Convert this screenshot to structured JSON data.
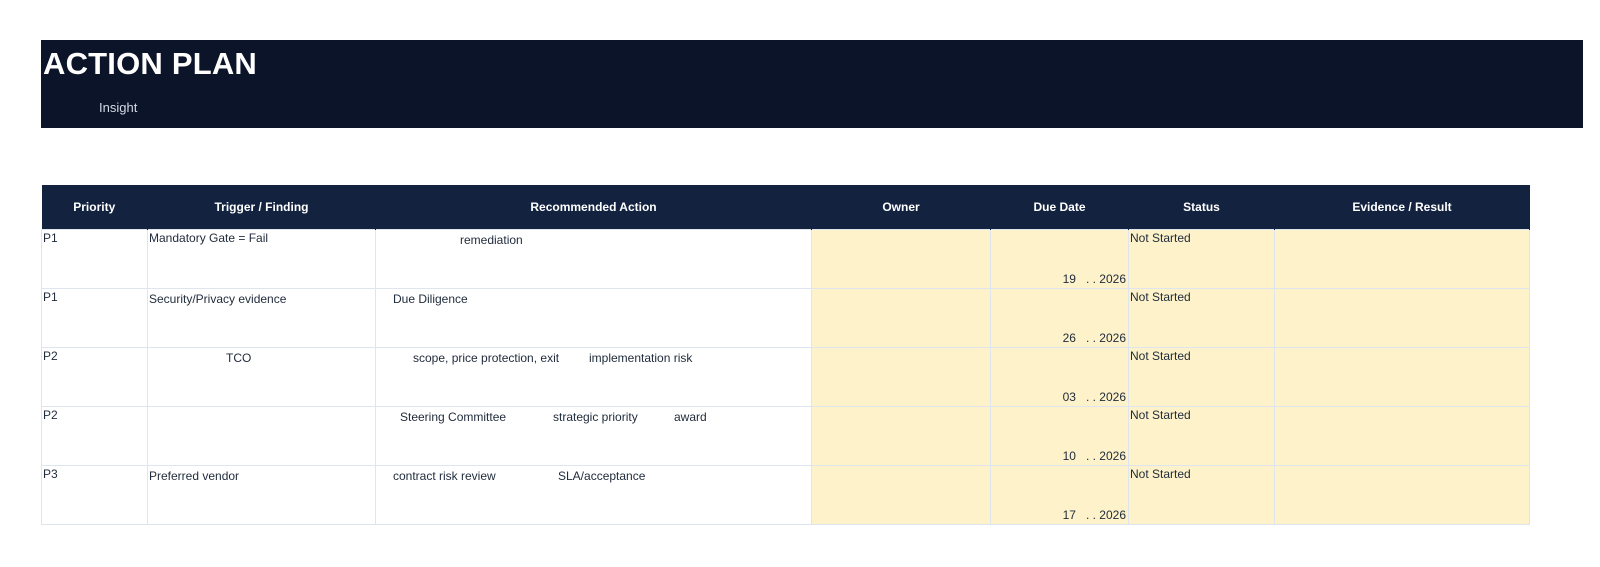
{
  "header": {
    "title": "ACTION PLAN",
    "subtitle": "Insight"
  },
  "table": {
    "columns": [
      "Priority",
      "Trigger / Finding",
      "Recommended Action",
      "Owner",
      "Due Date",
      "Status",
      "Evidence / Result"
    ],
    "rows": [
      {
        "priority": "P1",
        "trigger": "Mandatory Gate = Fail",
        "action": [
          "remediation"
        ],
        "owner": "",
        "due_day": "19",
        "due_sep": ". .",
        "due_year": "2026",
        "status": "Not Started",
        "evidence": ""
      },
      {
        "priority": "P1",
        "trigger": "Security/Privacy evidence",
        "action": [
          "Due Diligence"
        ],
        "owner": "",
        "due_day": "26",
        "due_sep": ". .",
        "due_year": "2026",
        "status": "Not Started",
        "evidence": ""
      },
      {
        "priority": "P2",
        "trigger": "TCO",
        "action": [
          "scope, price protection, exit",
          "implementation risk"
        ],
        "owner": "",
        "due_day": "03",
        "due_sep": ". .",
        "due_year": "2026",
        "status": "Not Started",
        "evidence": ""
      },
      {
        "priority": "P2",
        "trigger": "",
        "action": [
          "Steering Committee",
          "strategic priority",
          "award"
        ],
        "owner": "",
        "due_day": "10",
        "due_sep": ". .",
        "due_year": "2026",
        "status": "Not Started",
        "evidence": ""
      },
      {
        "priority": "P3",
        "trigger": "Preferred vendor",
        "action": [
          "contract risk review",
          "SLA/acceptance"
        ],
        "owner": "",
        "due_day": "17",
        "due_sep": ". .",
        "due_year": "2026",
        "status": "Not Started",
        "evidence": ""
      }
    ]
  }
}
